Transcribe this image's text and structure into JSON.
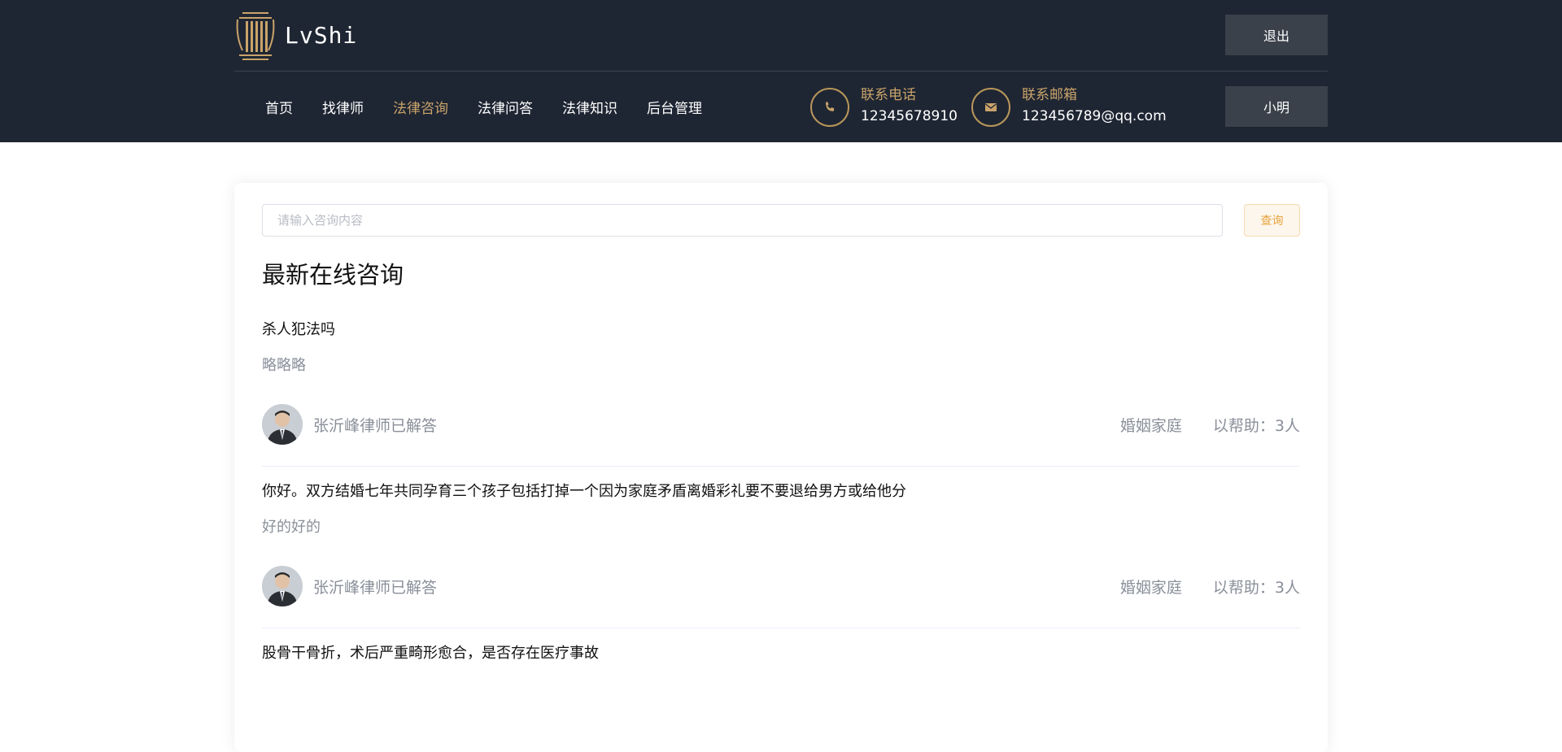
{
  "brand": {
    "name": "LvShi",
    "gold": "#c9a36a",
    "dark": "#1f2633"
  },
  "header": {
    "logout_label": "退出",
    "user_label": "小明",
    "nav": [
      {
        "label": "首页",
        "active": false
      },
      {
        "label": "找律师",
        "active": false
      },
      {
        "label": "法律咨询",
        "active": true
      },
      {
        "label": "法律问答",
        "active": false
      },
      {
        "label": "法律知识",
        "active": false
      },
      {
        "label": "后台管理",
        "active": false
      }
    ],
    "phone": {
      "label": "联系电话",
      "value": "12345678910",
      "icon": "phone-icon"
    },
    "email": {
      "label": "联系邮箱",
      "value": "123456789@qq.com",
      "icon": "mail-icon"
    }
  },
  "search": {
    "placeholder": "请输入咨询内容",
    "button_label": "查询"
  },
  "main": {
    "title": "最新在线咨询",
    "items": [
      {
        "question": "杀人犯法吗",
        "answer": "略略略",
        "lawyer": "张沂峰律师已解答",
        "category": "婚姻家庭",
        "helped": "以帮助：3人"
      },
      {
        "question": "你好。双方结婚七年共同孕育三个孩子包括打掉一个因为家庭矛盾离婚彩礼要不要退给男方或给他分",
        "answer": "好的好的",
        "lawyer": "张沂峰律师已解答",
        "category": "婚姻家庭",
        "helped": "以帮助：3人"
      },
      {
        "question": "股骨干骨折，术后严重畸形愈合，是否存在医疗事故",
        "answer": "",
        "lawyer": "",
        "category": "",
        "helped": ""
      }
    ]
  }
}
